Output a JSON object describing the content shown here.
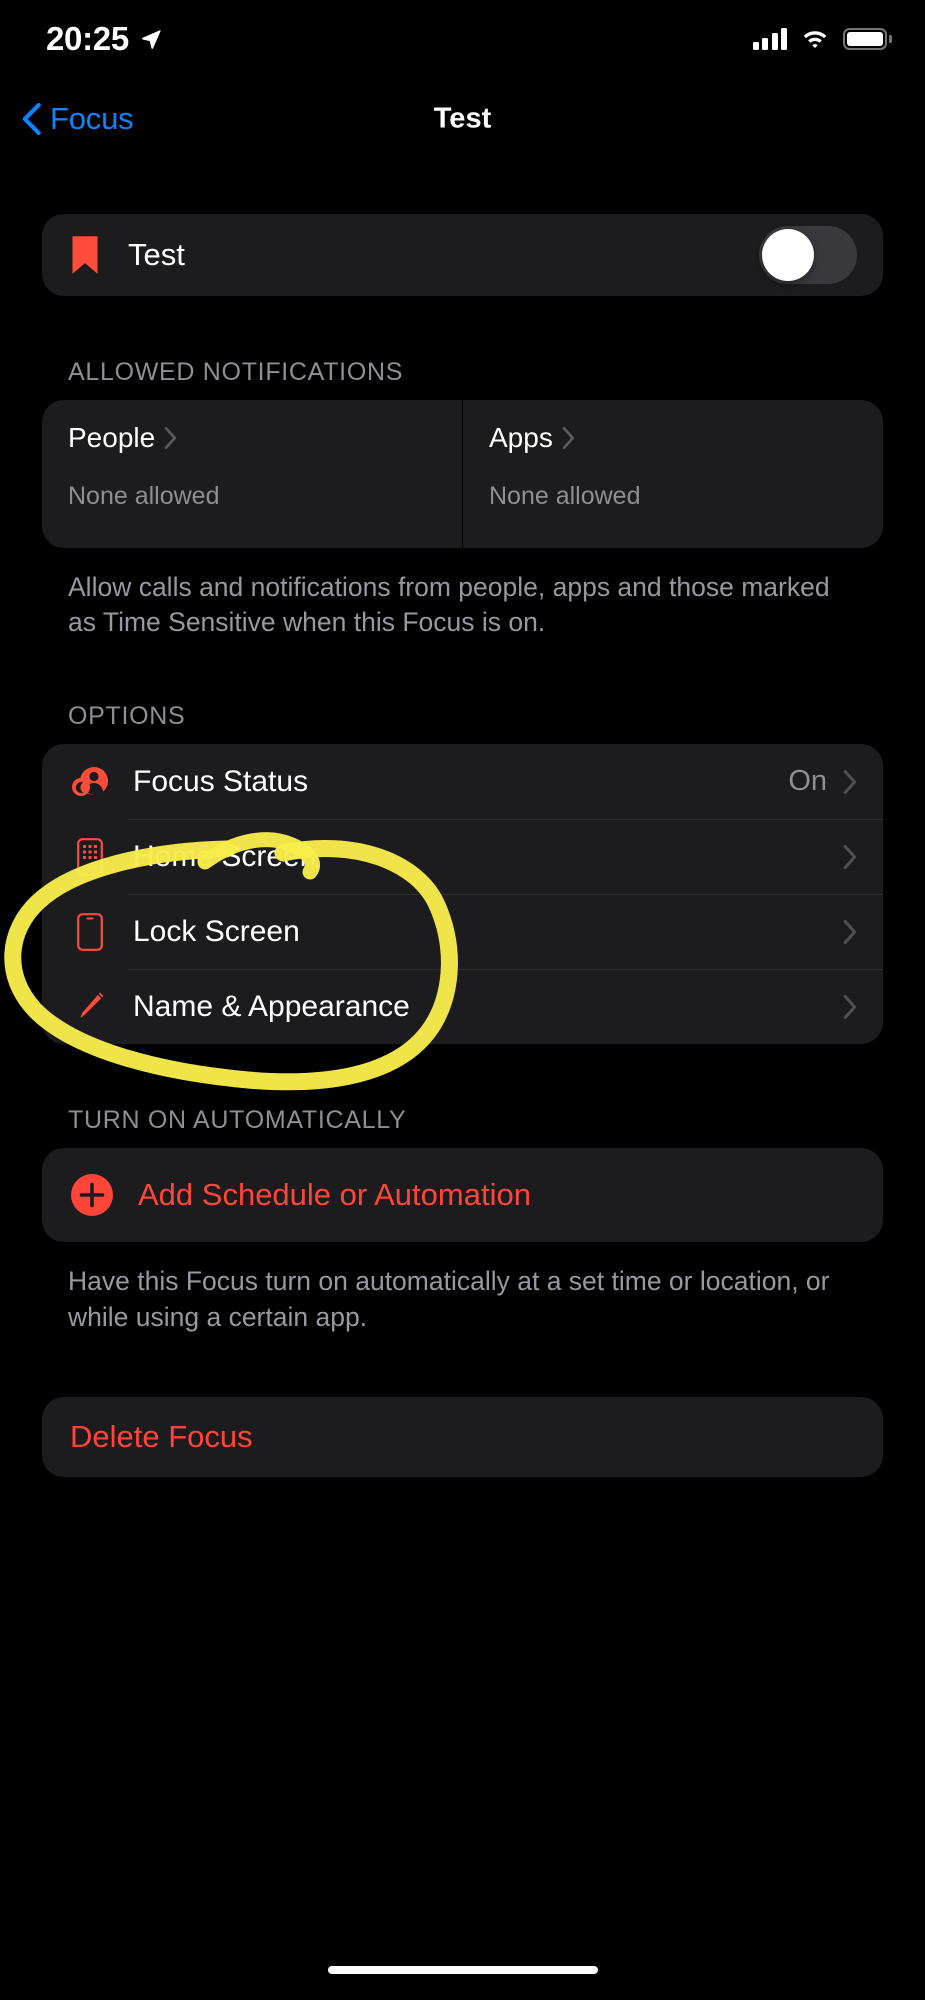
{
  "status_bar": {
    "time": "20:25",
    "location_icon": "location-arrow-icon",
    "cellular_icon": "cellular-bars-icon",
    "wifi_icon": "wifi-icon",
    "battery_icon": "battery-full-icon"
  },
  "nav": {
    "back_label": "Focus",
    "back_icon": "chevron-left-icon",
    "title": "Test",
    "accent_color": "#0A84FF"
  },
  "focus_card": {
    "icon": "bookmark-icon",
    "name": "Test",
    "toggle_state": "off"
  },
  "allowed_notifications": {
    "header": "ALLOWED NOTIFICATIONS",
    "cells": [
      {
        "title": "People",
        "subtitle": "None allowed",
        "chevron": "chevron-right-icon"
      },
      {
        "title": "Apps",
        "subtitle": "None allowed",
        "chevron": "chevron-right-icon"
      }
    ],
    "footer": "Allow calls and notifications from people, apps and those marked as Time Sensitive when this Focus is on."
  },
  "options": {
    "header": "OPTIONS",
    "rows": [
      {
        "label": "Focus Status",
        "value": "On",
        "icon": "focus-status-person-moon-icon",
        "chevron": "chevron-right-icon"
      },
      {
        "label": "Home Screen",
        "value": "",
        "icon": "home-screen-grid-icon",
        "chevron": "chevron-right-icon"
      },
      {
        "label": "Lock Screen",
        "value": "",
        "icon": "lock-screen-phone-icon",
        "chevron": "chevron-right-icon"
      },
      {
        "label": "Name & Appearance",
        "value": "",
        "icon": "pencil-icon",
        "chevron": "chevron-right-icon"
      }
    ]
  },
  "turn_on_automatically": {
    "header": "TURN ON AUTOMATICALLY",
    "add_label": "Add Schedule or Automation",
    "add_icon": "plus-circle-icon",
    "footer": "Have this Focus turn on automatically at a set time or location, or while using a certain app."
  },
  "delete": {
    "label": "Delete Focus"
  },
  "annotation": {
    "type": "hand-drawn-circle",
    "color": "#F7EC4B",
    "encircles": [
      "Lock Screen",
      "Name & Appearance"
    ]
  },
  "colors": {
    "background": "#000000",
    "card": "#1C1C1E",
    "accent_red": "#FF453A",
    "accent_blue": "#0A84FF",
    "secondary_text": "#8E8E93",
    "toggle_off_track": "#39393D"
  },
  "home_indicator": "home-indicator-bar"
}
